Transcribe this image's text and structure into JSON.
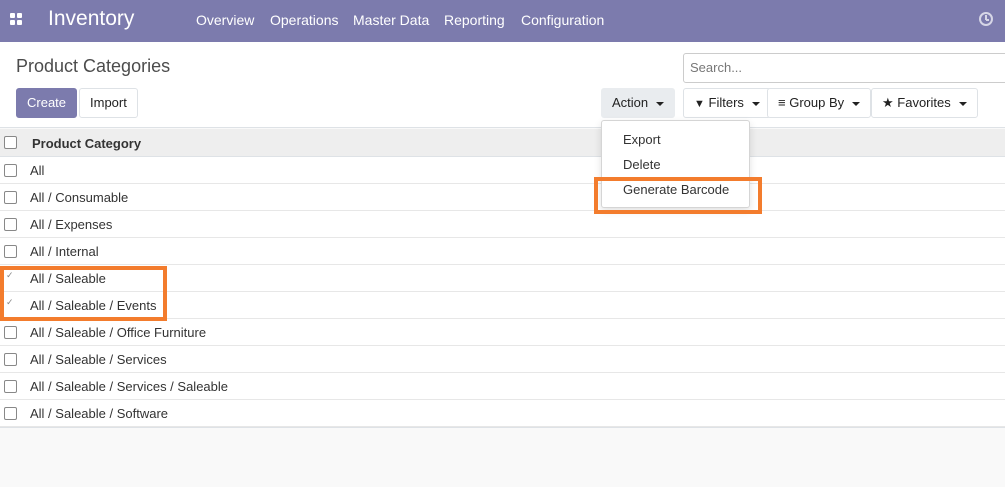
{
  "navbar": {
    "app_title": "Inventory",
    "menu": [
      "Overview",
      "Operations",
      "Master Data",
      "Reporting",
      "Configuration"
    ]
  },
  "control_panel": {
    "breadcrumb": "Product Categories",
    "create_label": "Create",
    "import_label": "Import",
    "action_label": "Action",
    "search_placeholder": "Search...",
    "filters_label": "Filters",
    "group_by_label": "Group By",
    "favorites_label": "Favorites"
  },
  "action_menu": {
    "items": [
      "Export",
      "Delete",
      "Generate Barcode"
    ]
  },
  "list": {
    "header": "Product Category",
    "rows": [
      {
        "label": "All",
        "checked": false
      },
      {
        "label": "All / Consumable",
        "checked": false
      },
      {
        "label": "All / Expenses",
        "checked": false
      },
      {
        "label": "All / Internal",
        "checked": false
      },
      {
        "label": "All / Saleable",
        "checked": true
      },
      {
        "label": "All / Saleable / Events",
        "checked": true
      },
      {
        "label": "All / Saleable / Office Furniture",
        "checked": false
      },
      {
        "label": "All / Saleable / Services",
        "checked": false
      },
      {
        "label": "All / Saleable / Services / Saleable",
        "checked": false
      },
      {
        "label": "All / Saleable / Software",
        "checked": false
      }
    ]
  },
  "colors": {
    "brand": "#7c7bad",
    "highlight": "#f37c2d"
  }
}
